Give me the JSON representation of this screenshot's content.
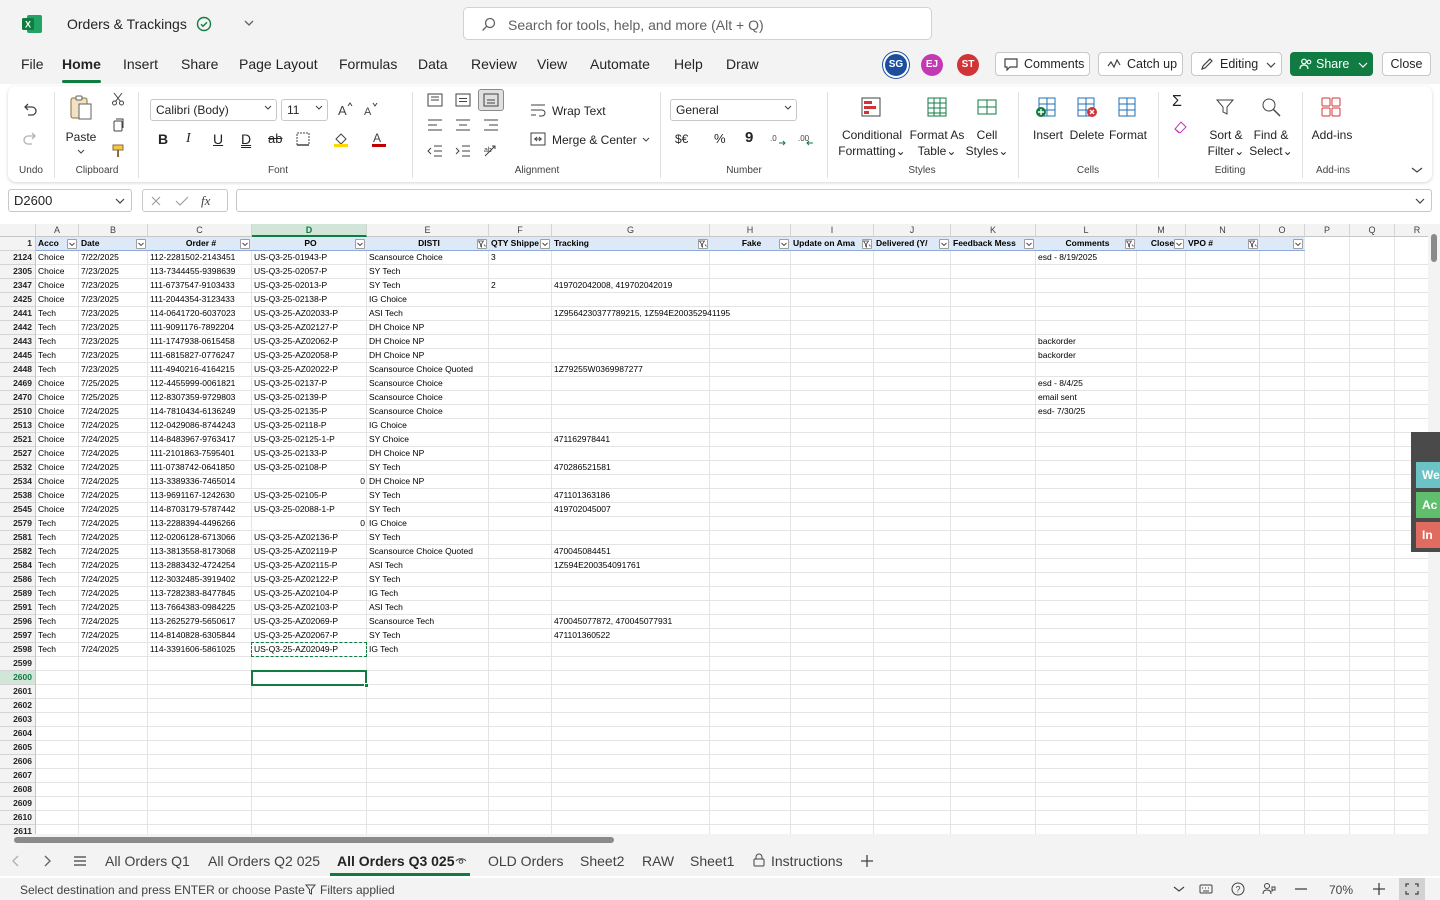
{
  "app": {
    "title": "Orders & Trackings",
    "search_placeholder": "Search for tools, help, and more (Alt + Q)"
  },
  "menu": [
    "File",
    "Home",
    "Insert",
    "Share",
    "Page Layout",
    "Formulas",
    "Data",
    "Review",
    "View",
    "Automate",
    "Help",
    "Draw"
  ],
  "avatars": [
    {
      "initials": "SG",
      "color": "#1c4e9e"
    },
    {
      "initials": "EJ",
      "color": "#c239b3"
    },
    {
      "initials": "ST",
      "color": "#d13438"
    }
  ],
  "header_buttons": {
    "comments": "Comments",
    "catchup": "Catch up",
    "editing": "Editing",
    "share": "Share",
    "close": "Close"
  },
  "ribbon": {
    "undo_group": "Undo",
    "clipboard_group": "Clipboard",
    "paste": "Paste",
    "font_group": "Font",
    "font_name": "Calibri (Body)",
    "font_size": "11",
    "alignment_group": "Alignment",
    "wrap_text": "Wrap Text",
    "merge_center": "Merge & Center",
    "number_group": "Number",
    "number_format": "General",
    "styles_group": "Styles",
    "conditional": "Conditional",
    "formatting": "Formatting",
    "format_as": "Format As",
    "table": "Table",
    "cell": "Cell",
    "styles": "Styles",
    "cells_group": "Cells",
    "insert": "Insert",
    "delete": "Delete",
    "format": "Format",
    "editing_group": "Editing",
    "sort": "Sort &",
    "filter": "Filter",
    "find": "Find &",
    "select": "Select",
    "addins_group": "Add-ins",
    "addins": "Add-ins"
  },
  "formula_bar": {
    "name_box": "D2600",
    "formula": ""
  },
  "columns": [
    "A",
    "B",
    "C",
    "D",
    "E",
    "F",
    "G",
    "H",
    "I",
    "J",
    "K",
    "L",
    "M",
    "N",
    "O",
    "P",
    "Q",
    "R"
  ],
  "headers": [
    "Acco",
    "Date",
    "Order #",
    "PO",
    "DISTI",
    "QTY Shippe",
    "Tracking",
    "Fake",
    "Update on Ama",
    "Delivered (Y/",
    "Feedback Mess",
    "Comments",
    "Close",
    "VPO #",
    "",
    "",
    "",
    ""
  ],
  "rows": [
    {
      "n": "2124",
      "a": "Choice",
      "b": "7/22/2025",
      "c": "112-2281502-2143451",
      "d": "US-Q3-25-01943-P",
      "e": "Scansource Choice",
      "f": "3",
      "g": "",
      "l": "esd - 8/19/2025"
    },
    {
      "n": "2305",
      "a": "Choice",
      "b": "7/23/2025",
      "c": "113-7344455-9398639",
      "d": "US-Q3-25-02057-P",
      "e": "SY Tech",
      "f": "",
      "g": "",
      "l": ""
    },
    {
      "n": "2347",
      "a": "Choice",
      "b": "7/23/2025",
      "c": "111-6737547-9103433",
      "d": "US-Q3-25-02013-P",
      "e": "SY Tech",
      "f": "2",
      "g": "419702042008, 419702042019",
      "l": ""
    },
    {
      "n": "2425",
      "a": "Choice",
      "b": "7/23/2025",
      "c": "111-2044354-3123433",
      "d": "US-Q3-25-02138-P",
      "e": "IG Choice",
      "f": "",
      "g": "",
      "l": ""
    },
    {
      "n": "2441",
      "a": "Tech",
      "b": "7/23/2025",
      "c": "114-0641720-6037023",
      "d": "US-Q3-25-AZ02033-P",
      "e": "ASI Tech",
      "f": "",
      "g": "1Z9564230377789215, 1Z594E200352941195",
      "l": ""
    },
    {
      "n": "2442",
      "a": "Tech",
      "b": "7/23/2025",
      "c": "111-9091176-7892204",
      "d": "US-Q3-25-AZ02127-P",
      "e": "DH Choice NP",
      "f": "",
      "g": "",
      "l": ""
    },
    {
      "n": "2443",
      "a": "Tech",
      "b": "7/23/2025",
      "c": "111-1747938-0615458",
      "d": "US-Q3-25-AZ02062-P",
      "e": "DH Choice NP",
      "f": "",
      "g": "",
      "l": "backorder"
    },
    {
      "n": "2445",
      "a": "Tech",
      "b": "7/23/2025",
      "c": "111-6815827-0776247",
      "d": "US-Q3-25-AZ02058-P",
      "e": "DH Choice NP",
      "f": "",
      "g": "",
      "l": "backorder"
    },
    {
      "n": "2448",
      "a": "Tech",
      "b": "7/23/2025",
      "c": "111-4940216-4164215",
      "d": "US-Q3-25-AZ02022-P",
      "e": "Scansource Choice Quoted",
      "f": "",
      "g": "1Z79255W0369987277",
      "l": ""
    },
    {
      "n": "2469",
      "a": "Choice",
      "b": "7/25/2025",
      "c": "112-4455999-0061821",
      "d": "US-Q3-25-02137-P",
      "e": "Scansource Choice",
      "f": "",
      "g": "",
      "l": "esd - 8/4/25"
    },
    {
      "n": "2470",
      "a": "Choice",
      "b": "7/25/2025",
      "c": "112-8307359-9729803",
      "d": "US-Q3-25-02139-P",
      "e": "Scansource Choice",
      "f": "",
      "g": "",
      "l": "email sent"
    },
    {
      "n": "2510",
      "a": "Choice",
      "b": "7/24/2025",
      "c": "114-7810434-6136249",
      "d": "US-Q3-25-02135-P",
      "e": "Scansource Choice",
      "f": "",
      "g": "",
      "l": "esd- 7/30/25"
    },
    {
      "n": "2513",
      "a": "Choice",
      "b": "7/24/2025",
      "c": "112-0429086-8744243",
      "d": "US-Q3-25-02118-P",
      "e": "IG Choice",
      "f": "",
      "g": "",
      "l": ""
    },
    {
      "n": "2521",
      "a": "Choice",
      "b": "7/24/2025",
      "c": "114-8483967-9763417",
      "d": "US-Q3-25-02125-1-P",
      "e": "SY Choice",
      "f": "",
      "g": "471162978441",
      "l": ""
    },
    {
      "n": "2527",
      "a": "Choice",
      "b": "7/24/2025",
      "c": "111-2101863-7595401",
      "d": "US-Q3-25-02133-P",
      "e": "DH Choice NP",
      "f": "",
      "g": "",
      "l": ""
    },
    {
      "n": "2532",
      "a": "Choice",
      "b": "7/24/2025",
      "c": "111-0738742-0641850",
      "d": "US-Q3-25-02108-P",
      "e": "SY Tech",
      "f": "",
      "g": "470286521581",
      "l": ""
    },
    {
      "n": "2534",
      "a": "Choice",
      "b": "7/24/2025",
      "c": "113-3389336-7465014",
      "d": "0",
      "e": "DH Choice NP",
      "f": "",
      "g": "",
      "l": ""
    },
    {
      "n": "2538",
      "a": "Choice",
      "b": "7/24/2025",
      "c": "113-9691167-1242630",
      "d": "US-Q3-25-02105-P",
      "e": "SY Tech",
      "f": "",
      "g": "471101363186",
      "l": ""
    },
    {
      "n": "2545",
      "a": "Choice",
      "b": "7/24/2025",
      "c": "114-8703179-5787442",
      "d": "US-Q3-25-02088-1-P",
      "e": "SY Tech",
      "f": "",
      "g": "419702045007",
      "l": ""
    },
    {
      "n": "2579",
      "a": "Tech",
      "b": "7/24/2025",
      "c": "113-2288394-4496266",
      "d": "0",
      "e": "IG Choice",
      "f": "",
      "g": "",
      "l": ""
    },
    {
      "n": "2581",
      "a": "Tech",
      "b": "7/24/2025",
      "c": "112-0206128-6713066",
      "d": "US-Q3-25-AZ02136-P",
      "e": "SY Tech",
      "f": "",
      "g": "",
      "l": ""
    },
    {
      "n": "2582",
      "a": "Tech",
      "b": "7/24/2025",
      "c": "113-3813558-8173068",
      "d": "US-Q3-25-AZ02119-P",
      "e": "Scansource Choice Quoted",
      "f": "",
      "g": "470045084451",
      "l": ""
    },
    {
      "n": "2584",
      "a": "Tech",
      "b": "7/24/2025",
      "c": "113-2883432-4724254",
      "d": "US-Q3-25-AZ02115-P",
      "e": "ASI Tech",
      "f": "",
      "g": "1Z594E200354091761",
      "l": ""
    },
    {
      "n": "2586",
      "a": "Tech",
      "b": "7/24/2025",
      "c": "112-3032485-3919402",
      "d": "US-Q3-25-AZ02122-P",
      "e": "SY Tech",
      "f": "",
      "g": "",
      "l": ""
    },
    {
      "n": "2589",
      "a": "Tech",
      "b": "7/24/2025",
      "c": "113-7282383-8477845",
      "d": "US-Q3-25-AZ02104-P",
      "e": "IG Tech",
      "f": "",
      "g": "",
      "l": ""
    },
    {
      "n": "2591",
      "a": "Tech",
      "b": "7/24/2025",
      "c": "113-7664383-0984225",
      "d": "US-Q3-25-AZ02103-P",
      "e": "ASI Tech",
      "f": "",
      "g": "",
      "l": ""
    },
    {
      "n": "2596",
      "a": "Tech",
      "b": "7/24/2025",
      "c": "113-2625279-5650617",
      "d": "US-Q3-25-AZ02069-P",
      "e": "Scansource Tech",
      "f": "",
      "g": "470045077872, 470045077931",
      "l": ""
    },
    {
      "n": "2597",
      "a": "Tech",
      "b": "7/24/2025",
      "c": "114-8140828-6305844",
      "d": "US-Q3-25-AZ02067-P",
      "e": "SY Tech",
      "f": "",
      "g": "471101360522",
      "l": ""
    },
    {
      "n": "2598",
      "a": "Tech",
      "b": "7/24/2025",
      "c": "114-3391606-5861025",
      "d": "US-Q3-25-AZ02049-P",
      "e": "IG Tech",
      "f": "",
      "g": "",
      "l": ""
    }
  ],
  "empty_rows": [
    "2599",
    "2600",
    "2601",
    "2602",
    "2603",
    "2604",
    "2605",
    "2606",
    "2607",
    "2608",
    "2609",
    "2610",
    "2611"
  ],
  "side_panel": [
    "We",
    "Ac",
    "In"
  ],
  "sheets": [
    "All Orders Q1",
    "All Orders Q2 025",
    "All Orders Q3 025",
    "OLD Orders",
    "Sheet2",
    "RAW",
    "Sheet1",
    "Instructions"
  ],
  "status": {
    "message": "Select destination and press ENTER or choose Paste",
    "filters": "Filters applied",
    "zoom": "70%"
  },
  "colors": {
    "accent": "#107c41",
    "header_fill": "#dde9f7"
  }
}
